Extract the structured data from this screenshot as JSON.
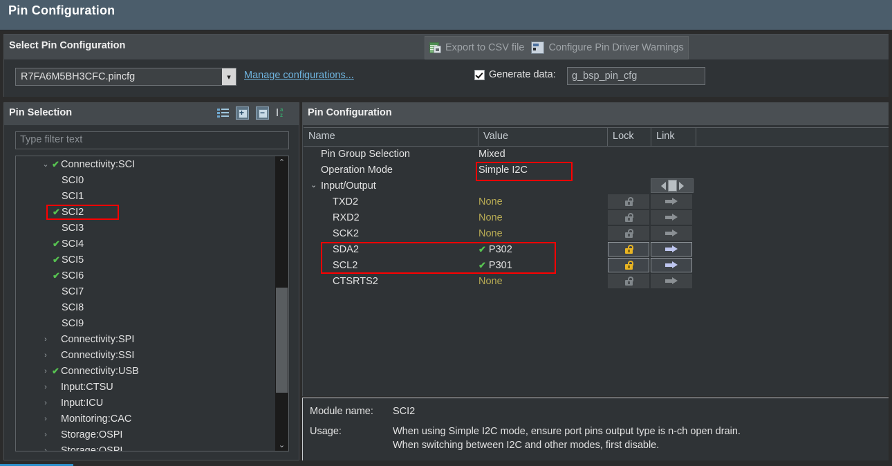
{
  "window": {
    "title": "Pin Configuration"
  },
  "select_group": {
    "title": "Select Pin Configuration",
    "actions": [
      {
        "label": "Export to CSV file",
        "icon": "csv-export-icon"
      },
      {
        "label": "Configure Pin Driver Warnings",
        "icon": "pin-driver-warnings-icon"
      }
    ],
    "pincfg_select": {
      "value": "R7FA6M5BH3CFC.pincfg"
    },
    "manage_link": "Manage configurations...",
    "generate": {
      "label": "Generate data:",
      "checked": true,
      "value": "g_bsp_pin_cfg"
    }
  },
  "pin_selection": {
    "title": "Pin Selection",
    "toolbar": [
      {
        "name": "show-list-icon"
      },
      {
        "name": "expand-all-icon"
      },
      {
        "name": "collapse-all-icon"
      },
      {
        "name": "sort-alpha-icon"
      }
    ],
    "filter": {
      "placeholder": "Type filter text",
      "value": ""
    },
    "tree": [
      {
        "label": "Connectivity:SCI",
        "level": 0,
        "twisty": "⌄",
        "checked": true,
        "highlight": false
      },
      {
        "label": "SCI0",
        "level": 1,
        "twisty": "",
        "checked": false,
        "highlight": false
      },
      {
        "label": "SCI1",
        "level": 1,
        "twisty": "",
        "checked": false,
        "highlight": false
      },
      {
        "label": "SCI2",
        "level": 1,
        "twisty": "",
        "checked": true,
        "highlight": true
      },
      {
        "label": "SCI3",
        "level": 1,
        "twisty": "",
        "checked": false,
        "highlight": false
      },
      {
        "label": "SCI4",
        "level": 1,
        "twisty": "",
        "checked": true,
        "highlight": false
      },
      {
        "label": "SCI5",
        "level": 1,
        "twisty": "",
        "checked": true,
        "highlight": false
      },
      {
        "label": "SCI6",
        "level": 1,
        "twisty": "",
        "checked": true,
        "highlight": false
      },
      {
        "label": "SCI7",
        "level": 1,
        "twisty": "",
        "checked": false,
        "highlight": false
      },
      {
        "label": "SCI8",
        "level": 1,
        "twisty": "",
        "checked": false,
        "highlight": false
      },
      {
        "label": "SCI9",
        "level": 1,
        "twisty": "",
        "checked": false,
        "highlight": false
      },
      {
        "label": "Connectivity:SPI",
        "level": 0,
        "twisty": "›",
        "checked": false,
        "highlight": false
      },
      {
        "label": "Connectivity:SSI",
        "level": 0,
        "twisty": "›",
        "checked": false,
        "highlight": false
      },
      {
        "label": "Connectivity:USB",
        "level": 0,
        "twisty": "›",
        "checked": true,
        "highlight": false
      },
      {
        "label": "Input:CTSU",
        "level": 0,
        "twisty": "›",
        "checked": false,
        "highlight": false
      },
      {
        "label": "Input:ICU",
        "level": 0,
        "twisty": "›",
        "checked": false,
        "highlight": false
      },
      {
        "label": "Monitoring:CAC",
        "level": 0,
        "twisty": "›",
        "checked": false,
        "highlight": false
      },
      {
        "label": "Storage:OSPI",
        "level": 0,
        "twisty": "›",
        "checked": false,
        "highlight": false
      },
      {
        "label": "Storage:QSPI",
        "level": 0,
        "twisty": "›",
        "checked": false,
        "highlight": false
      }
    ],
    "scroll": {
      "up_glyph": "⌃",
      "down_glyph": "⌄"
    }
  },
  "pin_configuration": {
    "title": "Pin Configuration",
    "columns": [
      "Name",
      "Value",
      "Lock",
      "Link",
      ""
    ],
    "rows": [
      {
        "name": "Pin Group Selection",
        "indent": 0,
        "twisty": "",
        "value": "Mixed",
        "value_kind": "normal",
        "lock": "none",
        "link": "none",
        "highlight": false
      },
      {
        "name": "Operation Mode",
        "indent": 0,
        "twisty": "",
        "value": "Simple I2C",
        "value_kind": "normal",
        "lock": "none",
        "link": "none",
        "highlight": true
      },
      {
        "name": "Input/Output",
        "indent": 0,
        "twisty": "⌄",
        "value": "",
        "value_kind": "normal",
        "lock": "none",
        "link": "nav",
        "highlight": false
      },
      {
        "name": "TXD2",
        "indent": 1,
        "twisty": "",
        "value": "None",
        "value_kind": "none",
        "lock": "gray",
        "link": "gray",
        "highlight": false
      },
      {
        "name": "RXD2",
        "indent": 1,
        "twisty": "",
        "value": "None",
        "value_kind": "none",
        "lock": "gray",
        "link": "gray",
        "highlight": false
      },
      {
        "name": "SCK2",
        "indent": 1,
        "twisty": "",
        "value": "None",
        "value_kind": "none",
        "lock": "gray",
        "link": "gray",
        "highlight": false
      },
      {
        "name": "SDA2",
        "indent": 1,
        "twisty": "",
        "value": "P302",
        "value_kind": "pin",
        "lock": "gold",
        "link": "blue",
        "highlight": true
      },
      {
        "name": "SCL2",
        "indent": 1,
        "twisty": "",
        "value": "P301",
        "value_kind": "pin",
        "lock": "gold",
        "link": "blue",
        "highlight": true
      },
      {
        "name": "CTSRTS2",
        "indent": 1,
        "twisty": "",
        "value": "None",
        "value_kind": "none",
        "lock": "gray",
        "link": "gray",
        "highlight": false
      }
    ]
  },
  "info": {
    "module_name_label": "Module name:",
    "module_name_value": "SCI2",
    "usage_label": "Usage:",
    "usage_line1": "When using Simple I2C mode, ensure port pins output type is n-ch open drain.",
    "usage_line2": "When switching between I2C and other modes, first disable."
  },
  "colors": {
    "title_bar": "#4b5d6b",
    "panel": "#2f3336",
    "header": "#44494d",
    "link": "#6fb5e0",
    "check_green": "#57c251",
    "value_none": "#b9ac54",
    "highlight": "#ff0000",
    "lock_gold": "#e8b423",
    "arrow_blue": "#bec6ef",
    "tab_accent": "#2d8fc9"
  }
}
